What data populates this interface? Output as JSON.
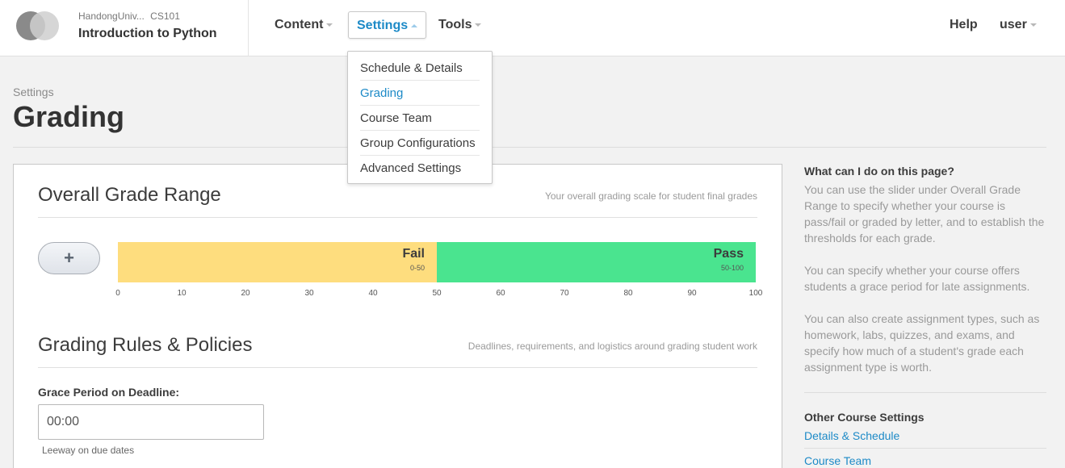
{
  "header": {
    "org": "HandongUniv...",
    "course_number": "CS101",
    "course_title": "Introduction to Python",
    "nav": {
      "content": "Content",
      "settings": "Settings",
      "tools": "Tools",
      "help": "Help",
      "user": "user"
    }
  },
  "settings_menu": {
    "items": [
      {
        "label": "Schedule & Details"
      },
      {
        "label": "Grading",
        "active": true
      },
      {
        "label": "Course Team"
      },
      {
        "label": "Group Configurations"
      },
      {
        "label": "Advanced Settings"
      }
    ]
  },
  "page": {
    "breadcrumb": "Settings",
    "title": "Grading"
  },
  "grade_range": {
    "title": "Overall Grade Range",
    "subtitle": "Your overall grading scale for student final grades",
    "add_label": "+",
    "segments": [
      {
        "name": "Fail",
        "range": "0-50",
        "min": 0,
        "max": 50,
        "color": "#fedd7e"
      },
      {
        "name": "Pass",
        "range": "50-100",
        "min": 50,
        "max": 100,
        "color": "#4ae48f"
      }
    ],
    "ticks": [
      "0",
      "10",
      "20",
      "30",
      "40",
      "50",
      "60",
      "70",
      "80",
      "90",
      "100"
    ]
  },
  "rules": {
    "title": "Grading Rules & Policies",
    "subtitle": "Deadlines, requirements, and logistics around grading student work",
    "grace_label": "Grace Period on Deadline:",
    "grace_value": "00:00",
    "grace_tip": "Leeway on due dates"
  },
  "sidebar": {
    "heading": "What can I do on this page?",
    "paragraphs": [
      "You can use the slider under Overall Grade Range to specify whether your course is pass/fail or graded by letter, and to establish the thresholds for each grade.",
      "You can specify whether your course offers students a grace period for late assignments.",
      "You can also create assignment types, such as homework, labs, quizzes, and exams, and specify how much of a student's grade each assignment type is worth."
    ],
    "other_heading": "Other Course Settings",
    "links": [
      "Details & Schedule",
      "Course Team"
    ]
  },
  "colors": {
    "accent": "#1d8ac7",
    "fail": "#fedd7e",
    "pass": "#4ae48f"
  }
}
